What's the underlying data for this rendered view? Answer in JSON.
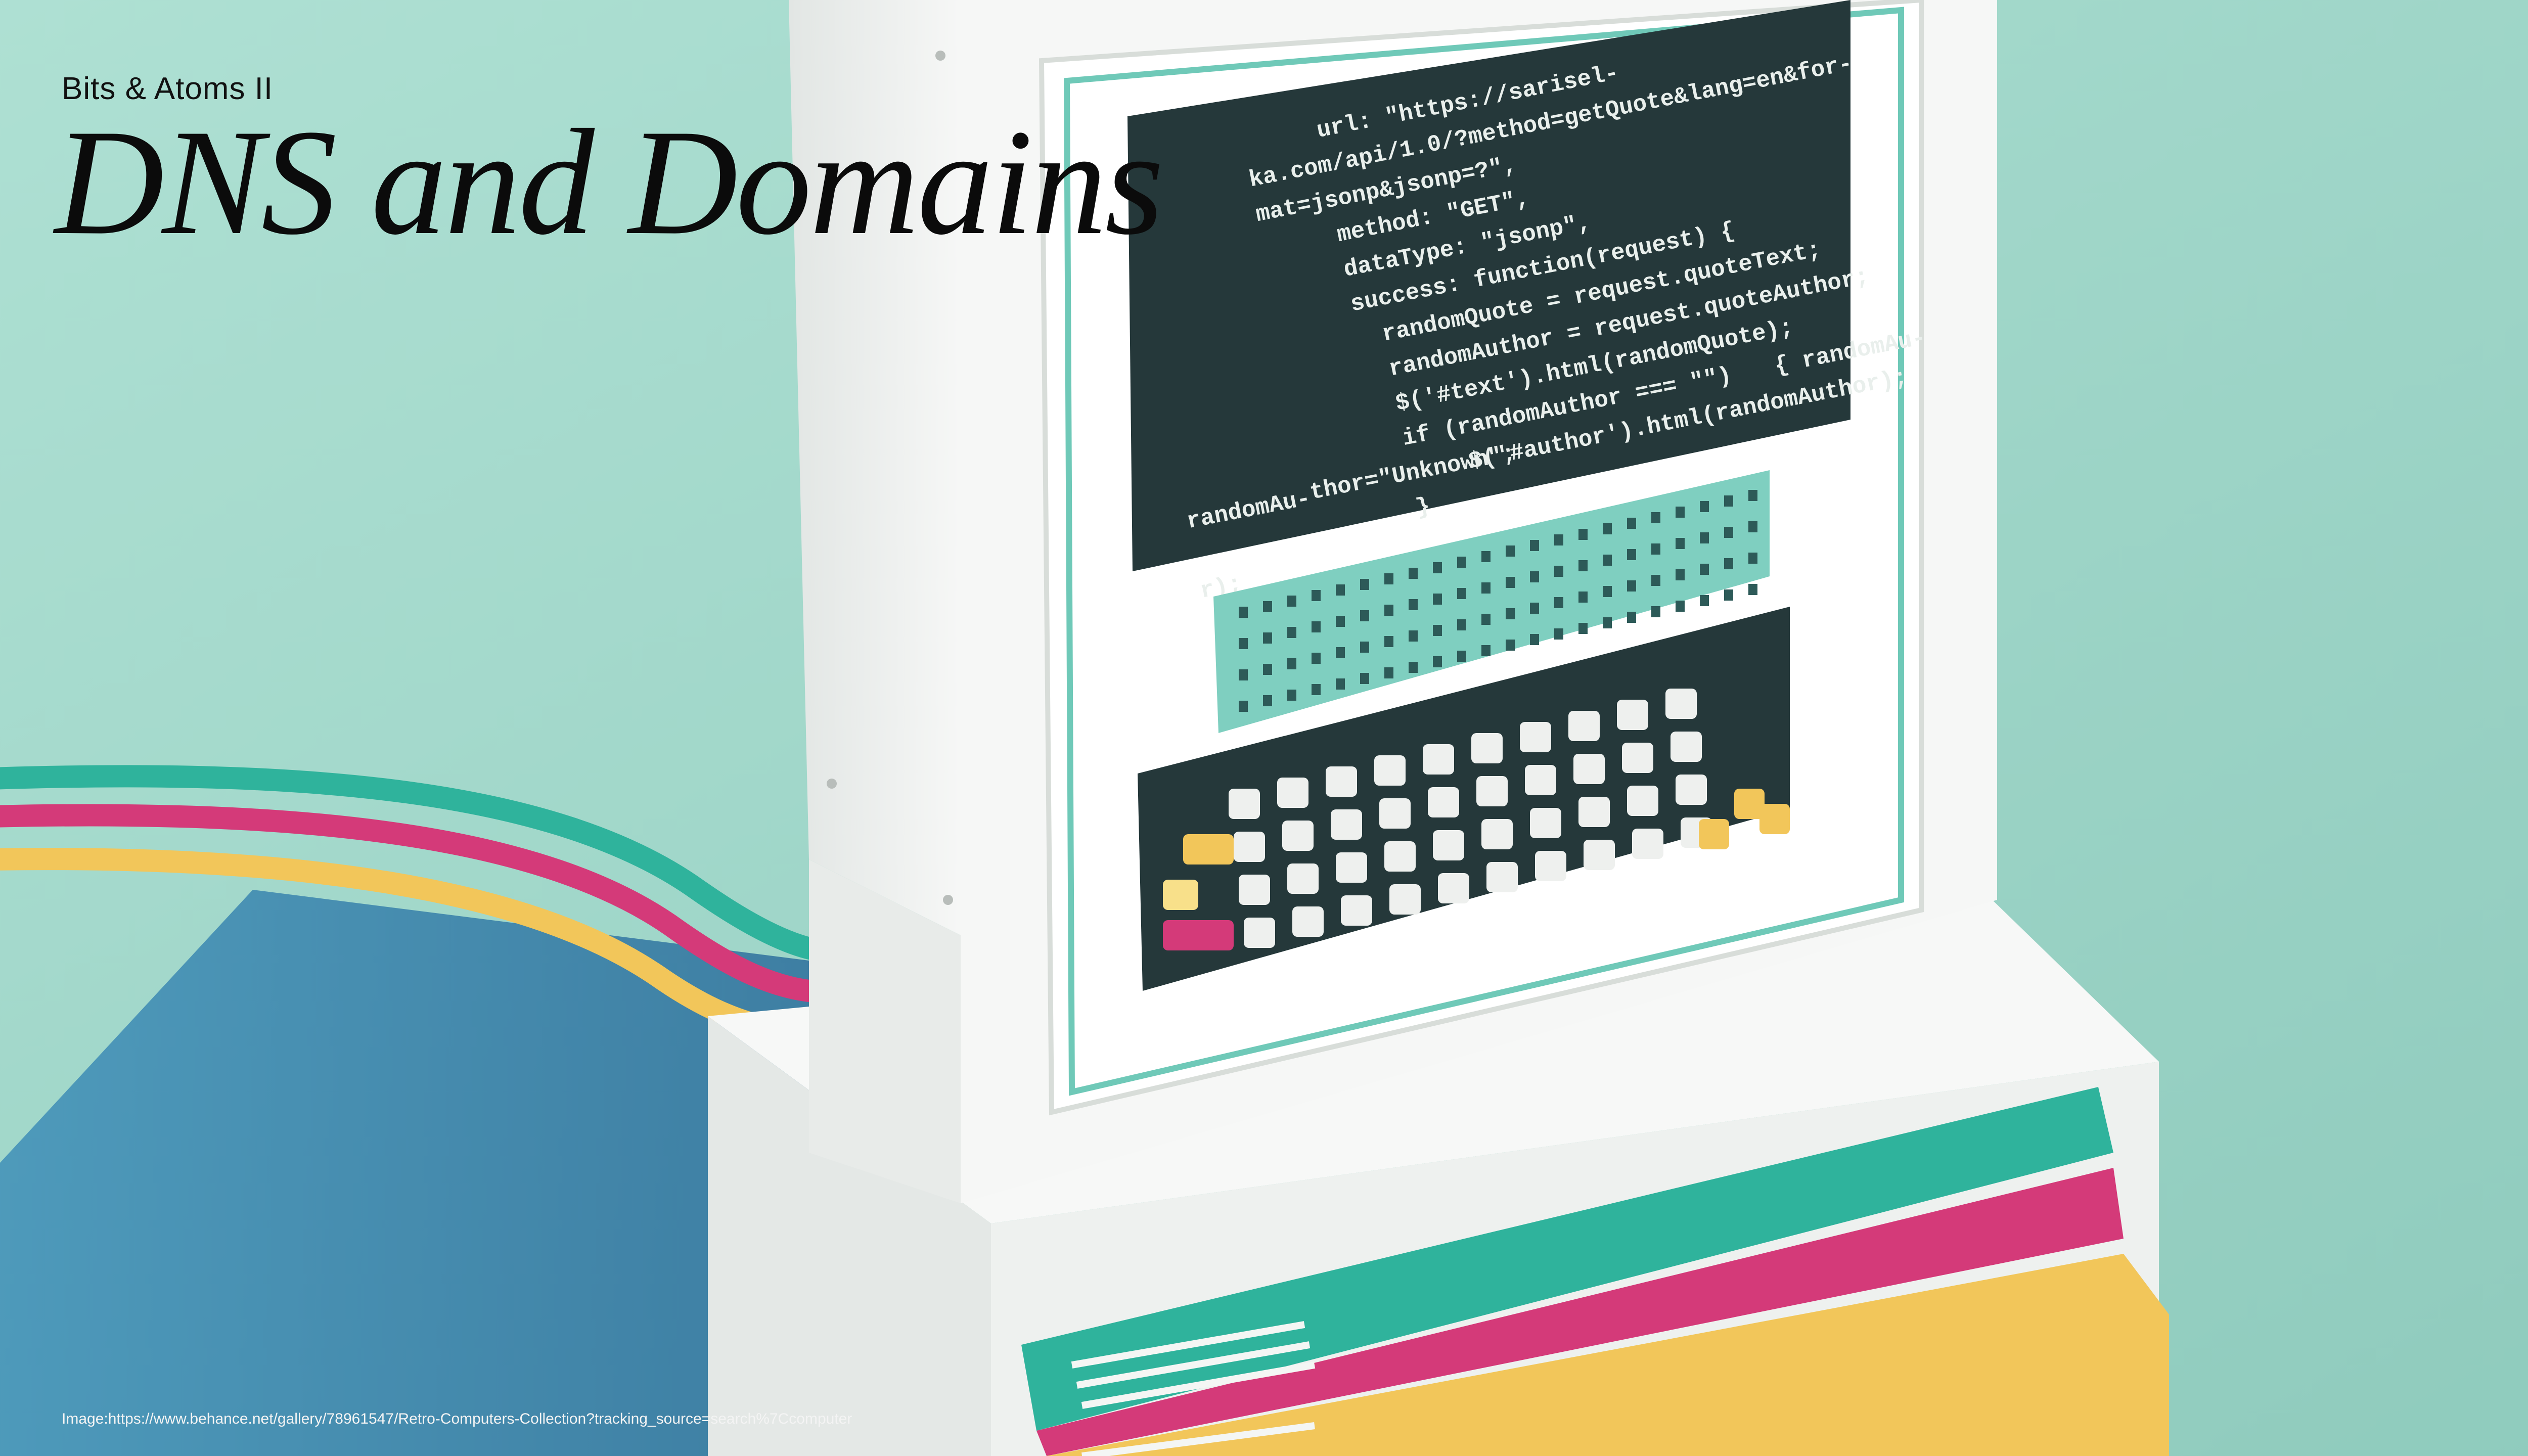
{
  "slide": {
    "subtitle": "Bits & Atoms II",
    "title": "DNS and Domains",
    "credit": "Image:https://www.behance.net/gallery/78961547/Retro-Computers-Collection?tracking_source=search%7Ccomputer"
  },
  "screen_code": [
    "url: \"https://sarisel-",
    "ka.com/api/1.0/?method=getQuote&lang=en&for-",
    "mat=jsonp&jsonp=?\",",
    "method: \"GET\",",
    "dataType: \"jsonp\",",
    "success: function(request) {",
    "randomQuote = request.quoteText;",
    "randomAuthor = request.quoteAuthor;",
    "$('#text').html(randomQuote);",
    "if (randomAuthor === \"\")",
    "{ randomAu-",
    "thor=\"Unknown\";",
    "$('#author').html(randomAuthor);",
    "}",
    "randomAu-",
    "r);"
  ],
  "colors": {
    "background": "#9fd6c8",
    "cable_teal": "#2fb39c",
    "cable_pink": "#d43a79",
    "cable_yellow": "#f2c65a",
    "screen": "#25383a",
    "body_white": "#f4f6f4"
  }
}
